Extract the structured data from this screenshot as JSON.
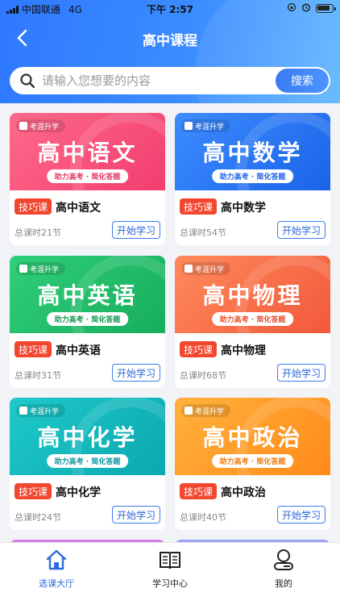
{
  "status_bar": {
    "carrier": "中国联通",
    "network": "4G",
    "time": "下午 2:57"
  },
  "nav": {
    "title": "高中课程"
  },
  "search": {
    "placeholder": "请输入您想要的内容",
    "button_label": "搜索"
  },
  "courses": [
    {
      "banner_title": "高中语文",
      "brand": "考涯升学",
      "slogan": "助力高考 · 简化答题",
      "badge": "技巧课",
      "name": "高中语文",
      "lessons": "总课时21节",
      "button": "开始学习",
      "color_from": "#ff6a8a",
      "color_to": "#f23d6f",
      "slogan_color": "#e8365f"
    },
    {
      "banner_title": "高中数学",
      "brand": "考涯升学",
      "slogan": "助力高考 · 简化答题",
      "badge": "技巧课",
      "name": "高中数学",
      "lessons": "总课时54节",
      "button": "开始学习",
      "color_from": "#3c8cff",
      "color_to": "#1a63e8",
      "slogan_color": "#1f63e3"
    },
    {
      "banner_title": "高中英语",
      "brand": "考涯升学",
      "slogan": "助力高考 · 简化答题",
      "badge": "技巧课",
      "name": "高中英语",
      "lessons": "总课时31节",
      "button": "开始学习",
      "color_from": "#2fcf7a",
      "color_to": "#17ad5c",
      "slogan_color": "#139a52"
    },
    {
      "banner_title": "高中物理",
      "brand": "考涯升学",
      "slogan": "助力高考 · 简化答题",
      "badge": "技巧课",
      "name": "高中物理",
      "lessons": "总课时68节",
      "button": "开始学习",
      "color_from": "#ff8a5c",
      "color_to": "#f2593b",
      "slogan_color": "#e5502f"
    },
    {
      "banner_title": "高中化学",
      "brand": "考涯升学",
      "slogan": "助力高考 · 简化答题",
      "badge": "技巧课",
      "name": "高中化学",
      "lessons": "总课时24节",
      "button": "开始学习",
      "color_from": "#1fc9c9",
      "color_to": "#0aa8b0",
      "slogan_color": "#0b98a1"
    },
    {
      "banner_title": "高中政治",
      "brand": "考涯升学",
      "slogan": "助力高考 · 简化答题",
      "badge": "技巧课",
      "name": "高中政治",
      "lessons": "总课时40节",
      "button": "开始学习",
      "color_from": "#ffb13d",
      "color_to": "#ff8a1a",
      "slogan_color": "#f07a0c"
    }
  ],
  "peek_colors": [
    "#d67be8",
    "#9aa3f2"
  ],
  "tabbar": [
    {
      "label": "选课大厅",
      "icon": "home-icon",
      "active": true
    },
    {
      "label": "学习中心",
      "icon": "book-icon",
      "active": false
    },
    {
      "label": "我的",
      "icon": "profile-icon",
      "active": false
    }
  ],
  "colors": {
    "accent": "#2d6be0",
    "badge_red": "#f2462f"
  }
}
